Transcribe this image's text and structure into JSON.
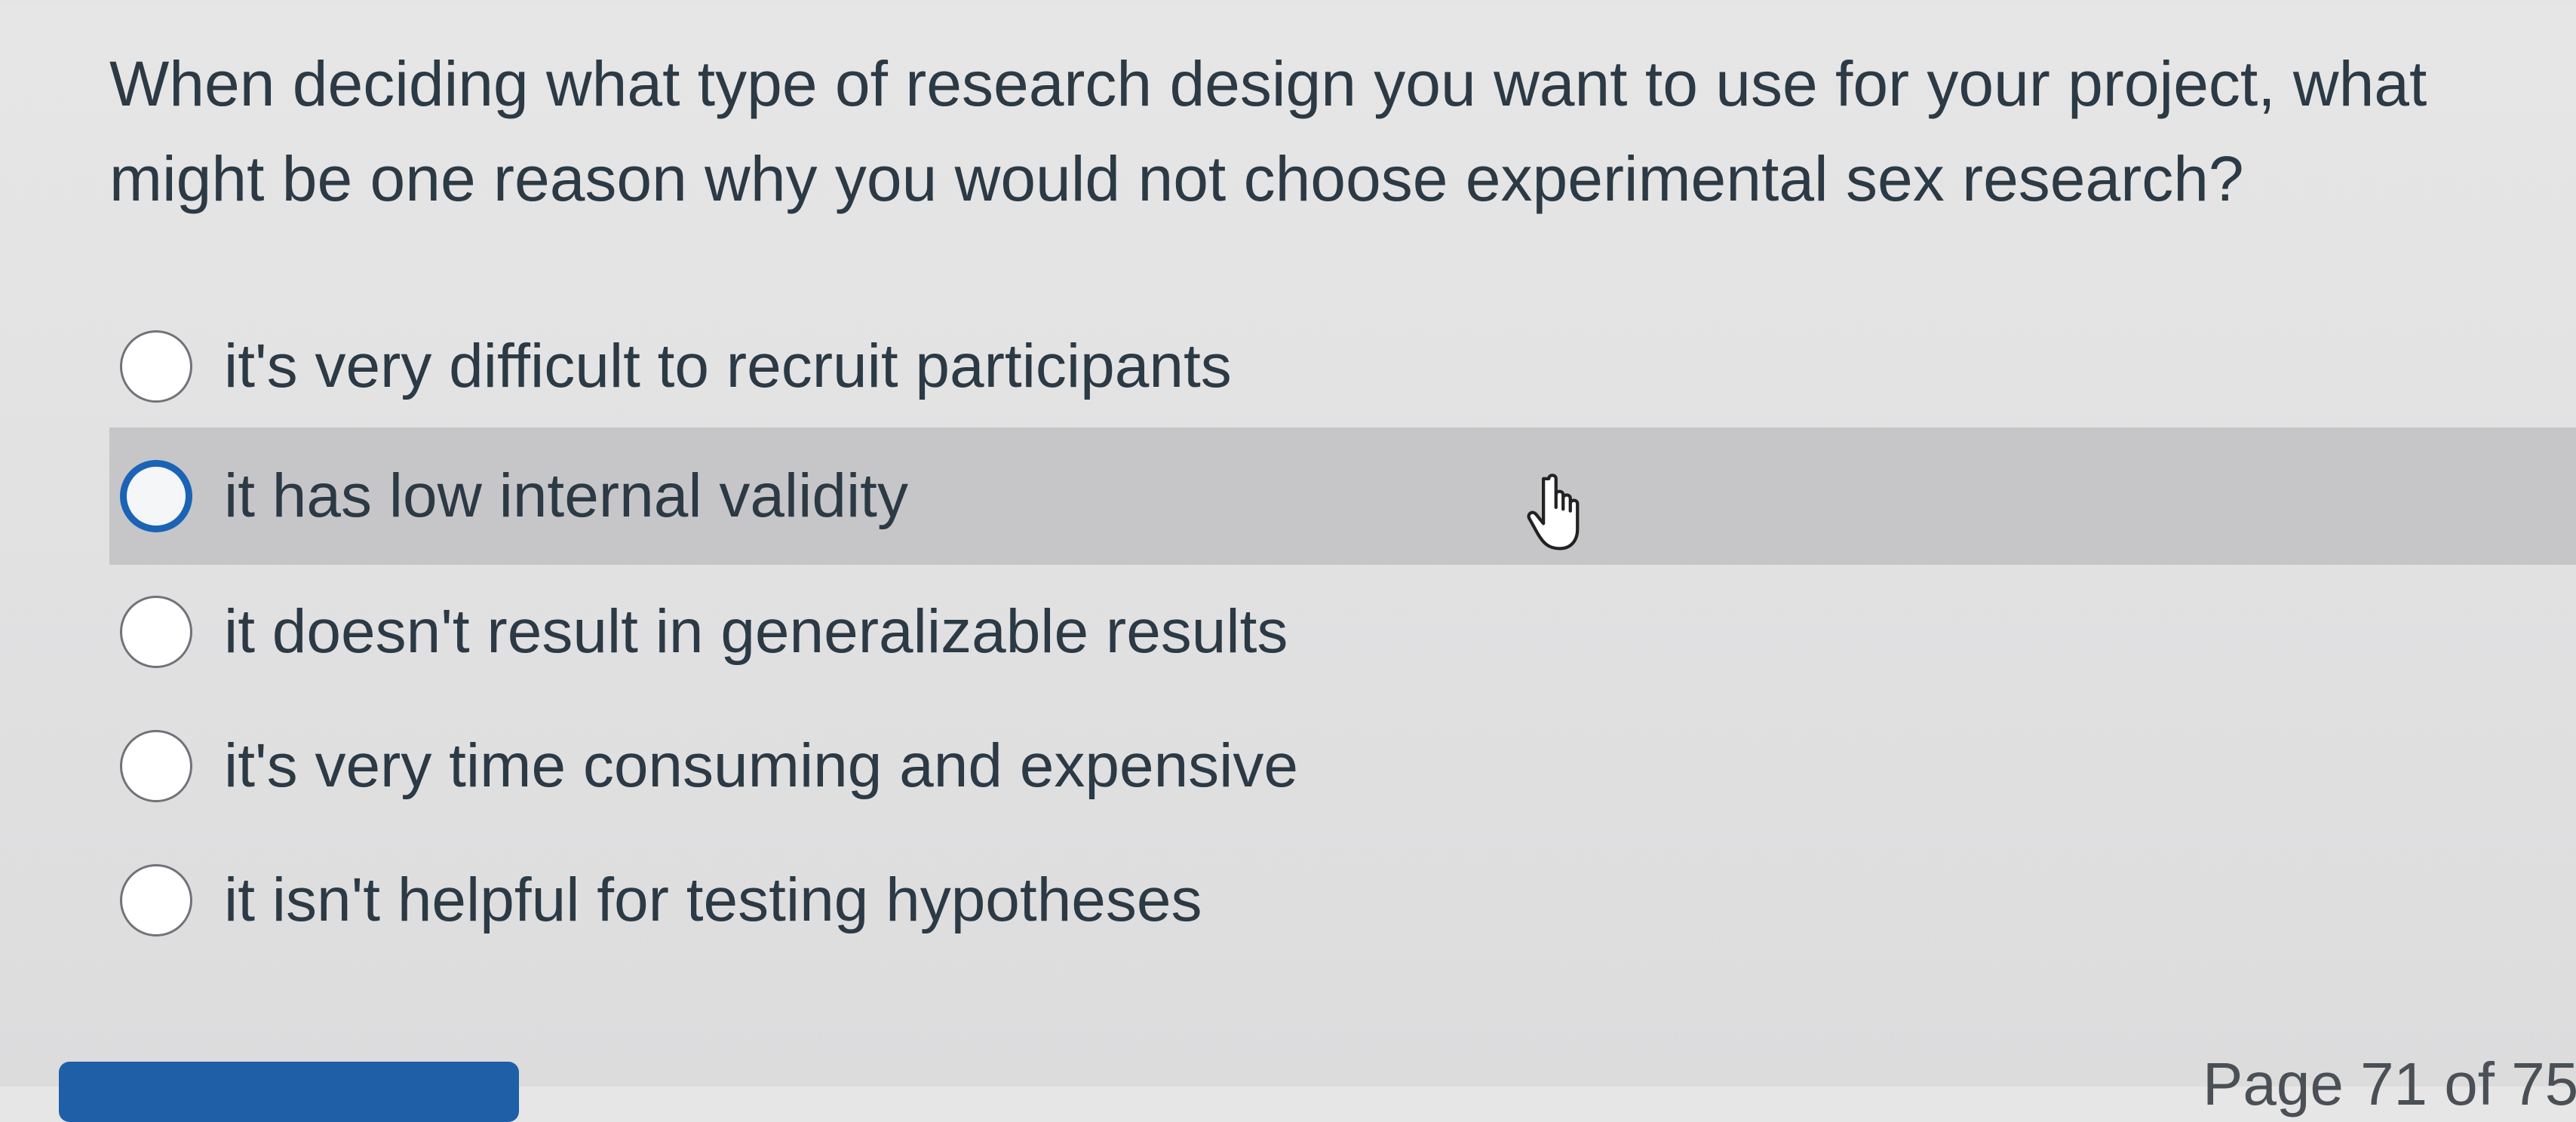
{
  "question": {
    "text": "When deciding what type of research design you want to use for your project, what might be one reason why you would not choose experimental sex research?"
  },
  "answers": [
    {
      "label": "it's very difficult to recruit participants",
      "hovered": false
    },
    {
      "label": "it has low internal validity",
      "hovered": true
    },
    {
      "label": "it doesn't result in generalizable results",
      "hovered": false
    },
    {
      "label": "it's very time consuming and expensive",
      "hovered": false
    },
    {
      "label": "it isn't helpful for testing hypotheses",
      "hovered": false
    }
  ],
  "pagination": {
    "text": "Page 71 of 75"
  },
  "colors": {
    "accent": "#1b63b5",
    "hover_background": "#c6c6c8",
    "text": "#2b3a44"
  },
  "icons": {
    "cursor": "hand-pointer-icon",
    "radio": "radio-button-icon"
  }
}
